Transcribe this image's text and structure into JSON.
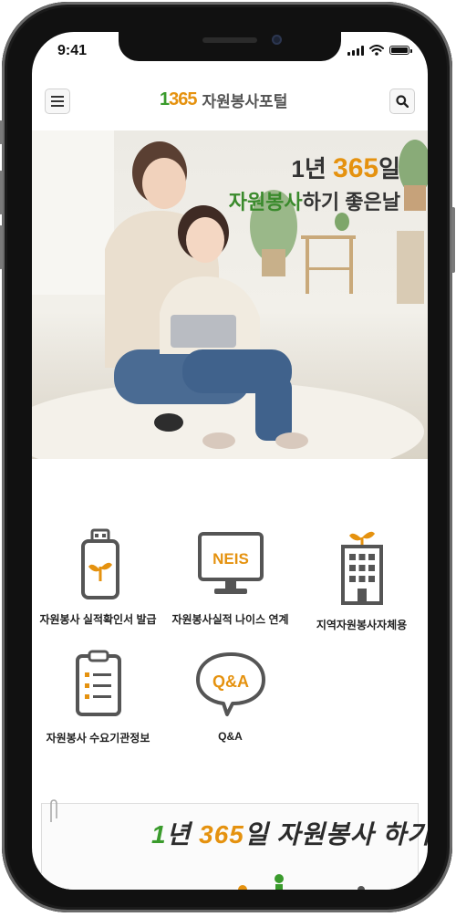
{
  "status_bar": {
    "time": "9:41"
  },
  "header": {
    "menu_icon": "hamburger-icon",
    "search_icon": "search-icon",
    "logo_number": "1365",
    "logo_text": "자원봉사포털"
  },
  "hero": {
    "line1_prefix": "1년 ",
    "line1_number": "365",
    "line1_suffix": "일",
    "line2_green": "자원봉사",
    "line2_rest": "하기 좋은날"
  },
  "menu": [
    {
      "label": "자원봉사 실적확인서 발급",
      "icon": "usb-sprout-icon"
    },
    {
      "label": "자원봉사실적 나이스 연계",
      "icon": "neis-monitor-icon",
      "icon_text": "NEIS"
    },
    {
      "label": "지역자원봉사자체용",
      "icon": "building-sprout-icon"
    },
    {
      "label": "자원봉사 수요기관정보",
      "icon": "clipboard-list-icon"
    },
    {
      "label": "Q&A",
      "icon": "qa-speech-bubble-icon",
      "icon_text": "Q&A"
    }
  ],
  "banner": {
    "prefix": "1",
    "word1": "년 ",
    "number": "365",
    "word2": "일 자원봉사 하기"
  },
  "colors": {
    "accent_orange": "#e5920f",
    "accent_green": "#3a9b2c",
    "icon_gray": "#555555"
  }
}
